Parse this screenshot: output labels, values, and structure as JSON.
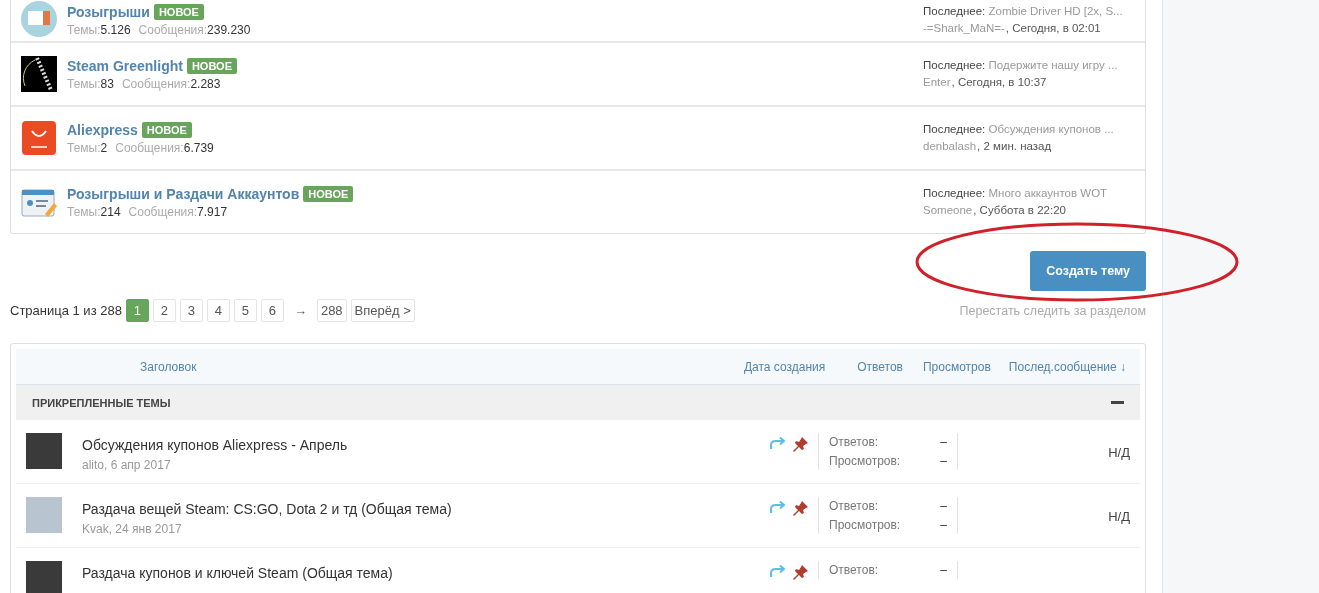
{
  "forums": [
    {
      "kind": "ticket",
      "title": "Розыгрыши",
      "badge": "НОВОЕ",
      "stats": [
        {
          "label": "Темы:",
          "value": "5.126"
        },
        {
          "label": "Сообщения:",
          "value": "239.230"
        }
      ],
      "last_label": "Последнее:",
      "last_title": "Zombie Driver HD [2x, S...",
      "last_user": "-=Shark_MaN=-",
      "last_time": ", Сегодня, в 02:01"
    },
    {
      "kind": "film",
      "title": "Steam Greenlight",
      "badge": "НОВОЕ",
      "stats": [
        {
          "label": "Темы:",
          "value": "83"
        },
        {
          "label": "Сообщения:",
          "value": "2.283"
        }
      ],
      "last_label": "Последнее:",
      "last_title": "Подержите нашу игру ...",
      "last_user": "Enter",
      "last_time": ", Сегодня, в 10:37"
    },
    {
      "kind": "bag",
      "title": "Aliexpress",
      "badge": "НОВОЕ",
      "stats": [
        {
          "label": "Темы:",
          "value": "2"
        },
        {
          "label": "Сообщения:",
          "value": "6.739"
        }
      ],
      "last_label": "Последнее:",
      "last_title": "Обсуждения купонов ...",
      "last_user": "denbalash",
      "last_time": ", 2 мин. назад"
    },
    {
      "kind": "account",
      "title": "Розыгрыши и Раздачи Аккаунтов",
      "badge": "НОВОЕ",
      "stats": [
        {
          "label": "Темы:",
          "value": "214"
        },
        {
          "label": "Сообщения:",
          "value": "7.917"
        }
      ],
      "last_label": "Последнее:",
      "last_title": "Много аккаунтов WOT",
      "last_user": "Someone",
      "last_time": ", Суббота в 22:20"
    }
  ],
  "create_button": "Создать тему",
  "pagination": {
    "label": "Страница 1 из 288",
    "pages": [
      {
        "label": "1",
        "selected": true
      },
      {
        "label": "2",
        "selected": false
      },
      {
        "label": "3",
        "selected": false
      },
      {
        "label": "4",
        "selected": false
      },
      {
        "label": "5",
        "selected": false
      },
      {
        "label": "6",
        "selected": false
      }
    ],
    "skip": "→",
    "last_page": "288",
    "next": "Вперёд >"
  },
  "unfollow_link": "Перестать следить за разделом",
  "table": {
    "columns": [
      "Заголовок",
      "Дата создания",
      "Ответов",
      "Просмотров",
      "Послед.сообщение ↓"
    ],
    "group": {
      "title": "ПРИКРЕПЛЕННЫЕ ТЕМЫ",
      "expanded": true
    },
    "rows": [
      {
        "title": "Обсуждения купонов Aliexpress - Апрель",
        "meta": "alito, 6 апр 2017",
        "moved": true,
        "sticky": true,
        "replies_label": "Ответов:",
        "replies": "–",
        "views_label": "Просмотров:",
        "views": "–",
        "last": "Н/Д"
      },
      {
        "title": "Раздача вещей Steam: CS:GO, Dota 2 и тд (Общая тема)",
        "meta": "Kvak, 24 янв 2017",
        "moved": true,
        "sticky": true,
        "replies_label": "Ответов:",
        "replies": "–",
        "views_label": "Просмотров:",
        "views": "–",
        "last": "Н/Д"
      },
      {
        "title": "Раздача купонов и ключей Steam (Общая тема)",
        "moved": true,
        "sticky": true,
        "replies_label": "Ответов:",
        "replies": "–"
      }
    ]
  },
  "annotation": {
    "kind": "ellipse"
  }
}
